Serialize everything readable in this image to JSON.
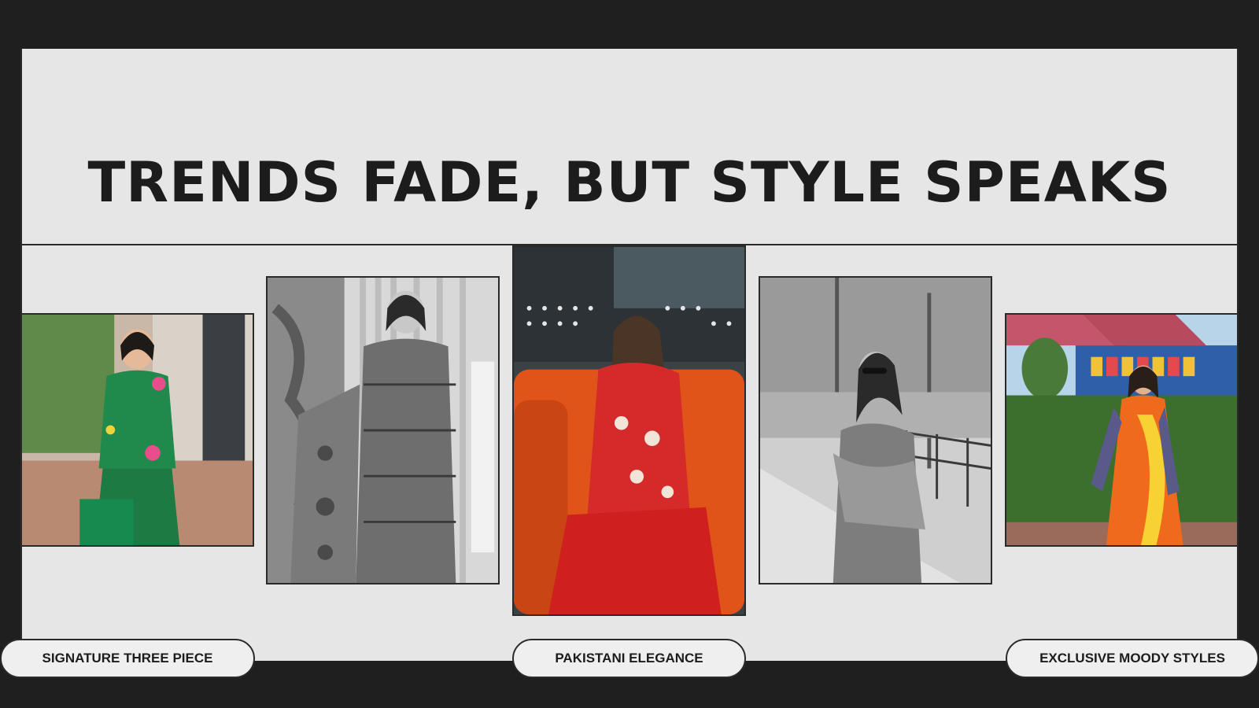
{
  "headline": "TRENDS FADE, BUT STYLE SPEAKS",
  "colors": {
    "frame": "#1f1f1f",
    "panel": "#e6e6e6",
    "text": "#1c1c1c",
    "accent_green": "#1f8a4c",
    "accent_red": "#d52a2a",
    "accent_orange": "#ef6a1d"
  },
  "photos": [
    {
      "name": "photo-green-three-piece",
      "tone": "color"
    },
    {
      "name": "photo-patterned-suit",
      "tone": "grayscale"
    },
    {
      "name": "photo-red-outfit-orange-sofa",
      "tone": "color"
    },
    {
      "name": "photo-sunglasses-outdoor",
      "tone": "grayscale"
    },
    {
      "name": "photo-orange-printed-dress",
      "tone": "color"
    }
  ],
  "buttons": {
    "left": "SIGNATURE THREE PIECE",
    "center": "PAKISTANI ELEGANCE",
    "right": "EXCLUSIVE MOODY STYLES"
  }
}
